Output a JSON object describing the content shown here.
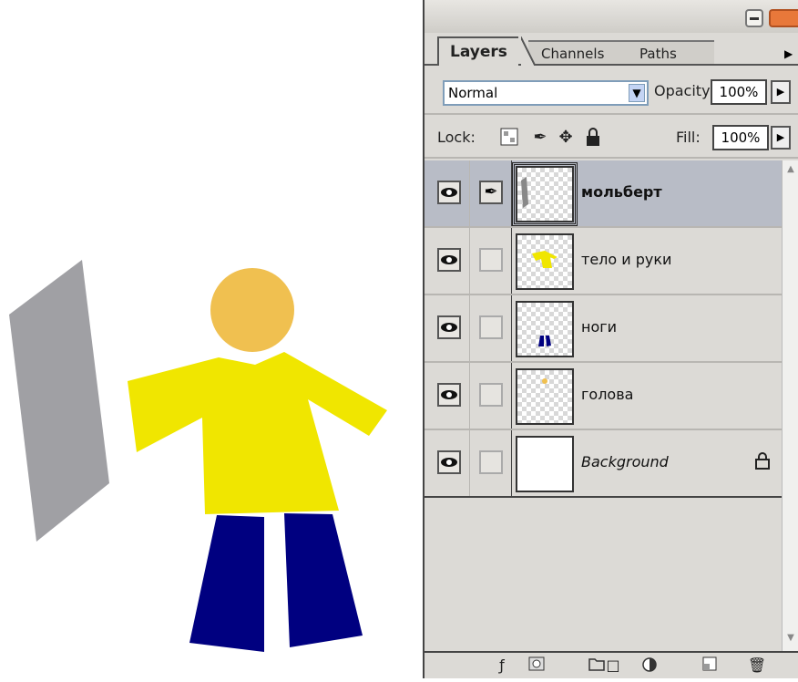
{
  "panel": {
    "tabs": [
      "Layers",
      "Channels",
      "Paths"
    ],
    "blend_mode": "Normal",
    "opacity_label": "Opacity:",
    "opacity_value": "100%",
    "lock_label": "Lock:",
    "fill_label": "Fill:",
    "fill_value": "100%"
  },
  "layers": [
    {
      "name": "мольберт",
      "visible": true,
      "selected": true
    },
    {
      "name": "тело и руки",
      "visible": true,
      "selected": false
    },
    {
      "name": "ноги",
      "visible": true,
      "selected": false
    },
    {
      "name": "голова",
      "visible": true,
      "selected": false
    },
    {
      "name": "Background",
      "visible": true,
      "selected": false,
      "locked": true
    }
  ],
  "colors": {
    "easel": "#a0a0a4",
    "head": "#f0c050",
    "body": "#f0e600",
    "legs": "#000080"
  },
  "icons": {
    "lock": [
      "lock-transparent-icon",
      "lock-paint-icon",
      "lock-move-icon",
      "lock-all-icon"
    ],
    "bottom": [
      "layer-style-icon",
      "layer-mask-icon",
      "new-group-icon",
      "adjustment-layer-icon",
      "new-layer-icon",
      "trash-icon"
    ]
  }
}
